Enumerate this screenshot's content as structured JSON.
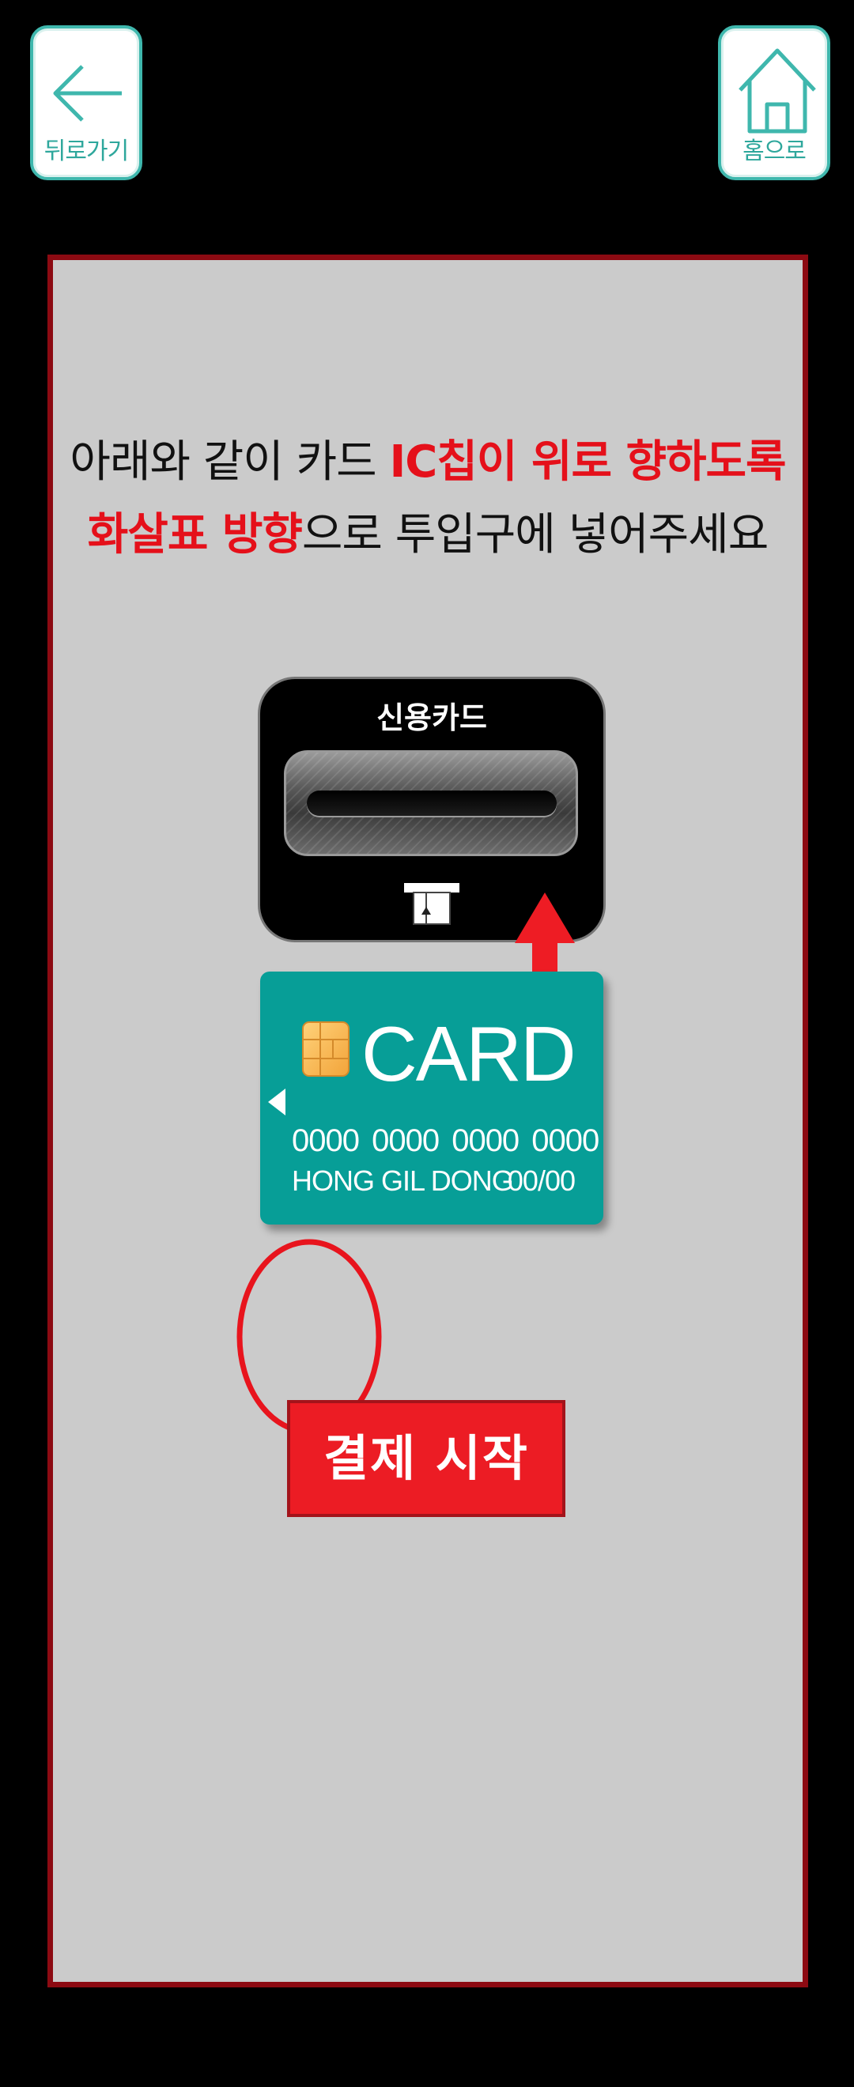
{
  "nav": {
    "back_label": "뒤로가기",
    "home_label": "홈으로"
  },
  "instruction": {
    "line1_plain": "아래와 같이 카드 ",
    "line1_highlight": "IC칩이 위로 향하도록",
    "line2_highlight": "화살표 방향",
    "line2_plain": "으로 투입구에 넣어주세요"
  },
  "reader": {
    "label": "신용카드"
  },
  "card": {
    "brand": "CARD",
    "number": "0000 0000 0000 0000",
    "holder": "HONG GIL DONG",
    "expiry": "00/00"
  },
  "actions": {
    "start_label": "결제 시작"
  },
  "colors": {
    "accent_teal": "#3fb7ad",
    "highlight_red": "#e5101a",
    "card_teal": "#079e97",
    "panel_border": "#8c0a12",
    "button_red": "#ec1c24"
  }
}
